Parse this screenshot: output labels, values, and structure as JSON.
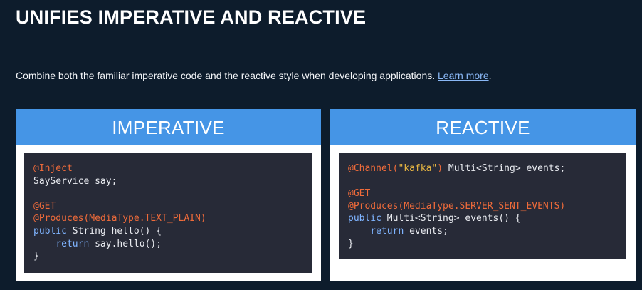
{
  "header": {
    "title": "UNIFIES IMPERATIVE AND REACTIVE"
  },
  "description": {
    "text": "Combine both the familiar imperative code and the reactive style when developing applications. ",
    "link_label": "Learn more",
    "trailing": "."
  },
  "panels": [
    {
      "title": "IMPERATIVE",
      "code": {
        "l1": "@Inject",
        "l2": "SayService say;",
        "l4": "@GET",
        "l5": "@Produces(MediaType.TEXT_PLAIN)",
        "l6_kw": "public",
        "l6_rest": " String hello() {",
        "l7_indent": "    ",
        "l7_kw": "return",
        "l7_rest": " say.hello();",
        "l8": "}"
      }
    },
    {
      "title": "REACTIVE",
      "code": {
        "l1_ann": "@Channel(",
        "l1_str": "\"kafka\"",
        "l1_ann2": ")",
        "l1_rest": " Multi<String> events;",
        "l3": "@GET",
        "l4": "@Produces(MediaType.SERVER_SENT_EVENTS)",
        "l5_kw": "public",
        "l5_rest": " Multi<String> events() {",
        "l6_indent": "    ",
        "l6_kw": "return",
        "l6_rest": " events;",
        "l7": "}"
      }
    }
  ],
  "colors": {
    "background": "#0d1c2c",
    "panel_header": "#4595e6",
    "code_background": "#272a37",
    "annotation": "#ef6b3a",
    "keyword": "#7fb4ff",
    "string": "#e5b442",
    "link": "#8ab8f6"
  }
}
